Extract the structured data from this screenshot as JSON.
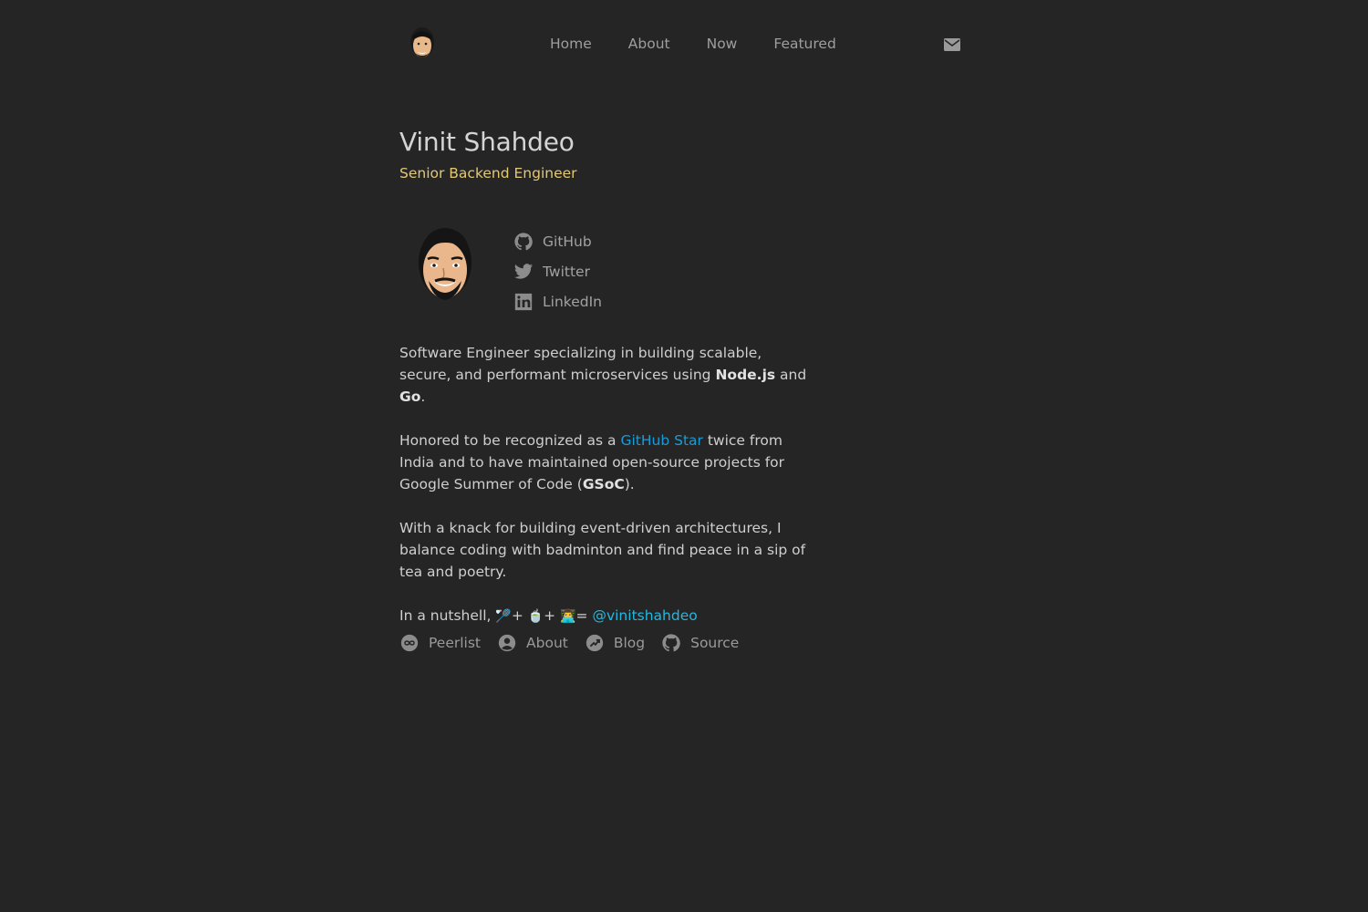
{
  "nav": {
    "logo_icon": "avatar-icon",
    "links": [
      "Home",
      "About",
      "Now",
      "Featured"
    ],
    "mail_icon": "mail-icon"
  },
  "profile": {
    "name": "Vinit Shahdeo",
    "role": "Senior Backend Engineer",
    "role_color": "#e3c874"
  },
  "socials": [
    {
      "label": "GitHub",
      "icon": "github-icon"
    },
    {
      "label": "Twitter",
      "icon": "twitter-icon"
    },
    {
      "label": "LinkedIn",
      "icon": "linkedin-icon"
    }
  ],
  "bio": {
    "p1_a": "Software Engineer specializing in building scalable, secure, and performant microservices using ",
    "p1_b1": "Node.js",
    "p1_c": " and ",
    "p1_b2": "Go",
    "p1_d": ".",
    "p2_a": "Honored to be recognized as a ",
    "p2_link": "GitHub Star",
    "p2_b": " twice from India and to have maintained open-source projects for Google Summer of Code (",
    "p2_bold": "GSoC",
    "p2_c": ").",
    "p3": "With a knack for building event-driven architectures, I balance coding with badminton and find peace in a sip of tea and poetry.",
    "p4_a": "In a nutshell, ",
    "p4_emoji1": "🏸",
    "p4_plus1": "+ ",
    "p4_emoji2": "🍵",
    "p4_plus2": "+ ",
    "p4_emoji3": "👨‍💻",
    "p4_eq": "= ",
    "p4_handle": "@vinitshahdeo"
  },
  "footer": [
    {
      "label": "Peerlist",
      "icon": "peerlist-icon"
    },
    {
      "label": "About",
      "icon": "user-circle-icon"
    },
    {
      "label": "Blog",
      "icon": "arrow-circle-icon"
    },
    {
      "label": "Source",
      "icon": "github-icon"
    }
  ],
  "colors": {
    "background": "#252525",
    "link_blue": "#1a9bd7",
    "link_cyan": "#22b8e0"
  }
}
